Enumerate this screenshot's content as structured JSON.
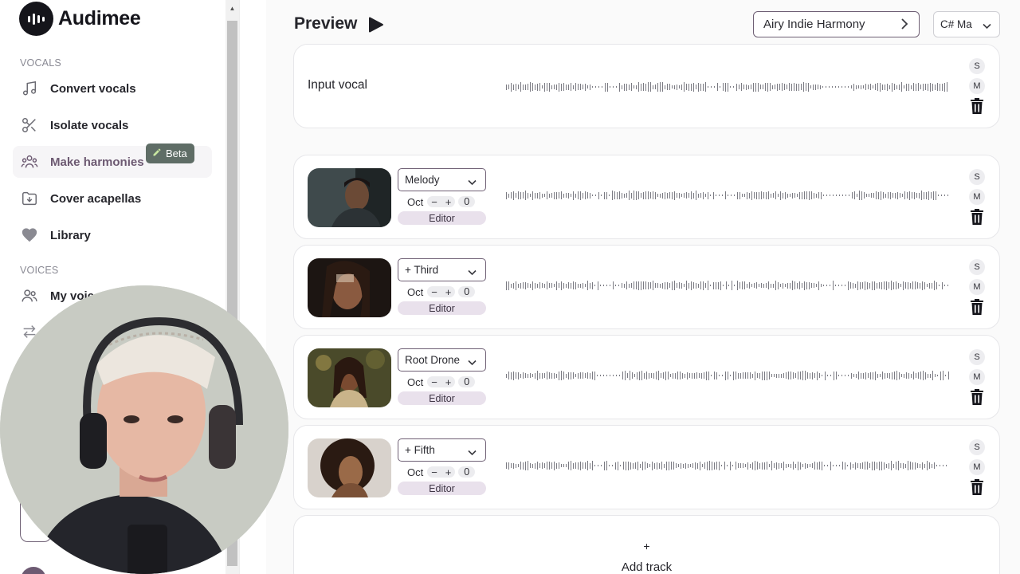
{
  "app": {
    "name": "Audimee"
  },
  "sidebar": {
    "sections": [
      {
        "label": "VOCALS"
      },
      {
        "label": "VOICES"
      }
    ],
    "items": [
      {
        "label": "Convert vocals",
        "icon": "music-note-icon"
      },
      {
        "label": "Isolate vocals",
        "icon": "scissors-icon"
      },
      {
        "label": "Make harmonies",
        "icon": "group-icon",
        "active": true
      },
      {
        "label": "Cover acapellas",
        "icon": "folder-download-icon"
      },
      {
        "label": "Library",
        "icon": "heart-icon"
      },
      {
        "label": "My voic",
        "icon": "users-icon"
      }
    ],
    "beta_badge": "Beta"
  },
  "header": {
    "title": "Preview",
    "preset": "Airy Indie Harmony",
    "key": "C# Ma"
  },
  "input_track": {
    "label": "Input vocal",
    "solo": "S",
    "mute": "M"
  },
  "tracks": [
    {
      "voice": "Melody",
      "oct_label": "Oct",
      "oct_minus": "−",
      "oct_plus": "+",
      "oct_value": "0",
      "editor": "Editor",
      "solo": "S",
      "mute": "M"
    },
    {
      "voice": "+ Third",
      "oct_label": "Oct",
      "oct_minus": "−",
      "oct_plus": "+",
      "oct_value": "0",
      "editor": "Editor",
      "solo": "S",
      "mute": "M"
    },
    {
      "voice": "Root Drone",
      "oct_label": "Oct",
      "oct_minus": "−",
      "oct_plus": "+",
      "oct_value": "0",
      "editor": "Editor",
      "solo": "S",
      "mute": "M"
    },
    {
      "voice": "+ Fifth",
      "oct_label": "Oct",
      "oct_minus": "−",
      "oct_plus": "+",
      "oct_value": "0",
      "editor": "Editor",
      "solo": "S",
      "mute": "M"
    }
  ],
  "add_track": {
    "plus": "+",
    "label": "Add track"
  },
  "colors": {
    "accent": "#6e5f74",
    "editor_bg": "#e9e1ec",
    "beta_bg": "#5f6d66"
  }
}
